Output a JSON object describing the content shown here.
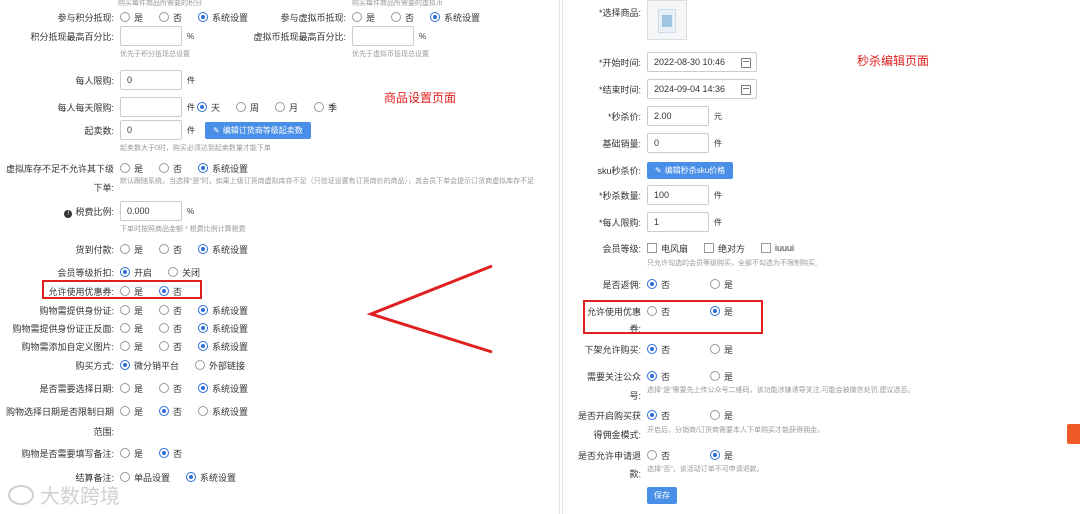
{
  "left": {
    "top_hints": [
      "购买每件商品所需要的积分",
      "购买每件商品所需要的虚拟币"
    ],
    "points_offset": {
      "label": "参与积分抵现:",
      "options": [
        "是",
        "否",
        "系统设置"
      ]
    },
    "virtual_offset": {
      "label": "参与虚拟币抵现:",
      "options": [
        "是",
        "否",
        "系统设置"
      ]
    },
    "points_pct": {
      "label": "积分抵现最高百分比:",
      "unit": "%",
      "hint": "优先于积分抵现总设置"
    },
    "virtual_pct": {
      "label": "虚拟币抵现最高百分比:",
      "unit": "%",
      "hint": "优先于虚拟币抵现总设置"
    },
    "per_person_limit": {
      "label": "每人限购:",
      "value": "0",
      "unit": "件"
    },
    "per_day_limit": {
      "label": "每人每天限购:",
      "unit": "件",
      "options": [
        "天",
        "周",
        "月",
        "季"
      ]
    },
    "min_qty": {
      "label": "起卖数:",
      "value": "0",
      "unit": "件",
      "button": "编辑订货商等级起卖数",
      "hint": "起卖数大于0时，购买必须达到起卖数量才能下单"
    },
    "virtual_stock": {
      "label_line1": "虚拟库存不足不允许其下级",
      "label_line2": "下单:",
      "options": [
        "是",
        "否",
        "系统设置"
      ],
      "hint": "默认跟随系统，当选择“是”时，如果上级订货商虚拟库存不足（只验证设置有订货商价的商品），其会员下单会提示订货商虚拟库存不足"
    },
    "tax_rate": {
      "label": "税费比例:",
      "value": "0.000",
      "unit": "%",
      "hint": "下单时按照商品金额 * 税费比例计算税费"
    },
    "cod": {
      "label": "货到付款:",
      "options": [
        "是",
        "否",
        "系统设置"
      ]
    },
    "member_discount": {
      "label": "会员等级折扣:",
      "options": [
        "开启",
        "关闭"
      ]
    },
    "allow_coupon": {
      "label": "允许使用优惠券:",
      "options": [
        "是",
        "否"
      ]
    },
    "need_id": {
      "label": "购物需提供身份证:",
      "options": [
        "是",
        "否",
        "系统设置"
      ]
    },
    "need_id_photo": {
      "label": "购物需提供身份证正反面:",
      "options": [
        "是",
        "否",
        "系统设置"
      ]
    },
    "need_custom_img": {
      "label": "购物需添加自定义图片:",
      "options": [
        "是",
        "否",
        "系统设置"
      ]
    },
    "buy_method": {
      "label": "购买方式:",
      "options": [
        "微分销平台",
        "外部链接"
      ]
    },
    "need_date": {
      "label": "是否需要选择日期:",
      "options": [
        "是",
        "否",
        "系统设置"
      ]
    },
    "date_range": {
      "label_line1": "购物选择日期是否限制日期",
      "label_line2": "范围:",
      "options": [
        "是",
        "否",
        "系统设置"
      ]
    },
    "need_note": {
      "label": "购物是否需要填写备注:",
      "options": [
        "是",
        "否"
      ]
    },
    "settle_note": {
      "label": "结算备注:",
      "options": [
        "单品设置",
        "系统设置"
      ]
    },
    "annotation": "商品设置页面"
  },
  "right": {
    "select_goods": {
      "label": "*选择商品:"
    },
    "start_time": {
      "label": "*开始时间:",
      "value": "2022-08-30 10:46"
    },
    "end_time": {
      "label": "*结束时间:",
      "value": "2024-09-04 14:36"
    },
    "price": {
      "label": "*秒杀价:",
      "value": "2.00",
      "unit": "元"
    },
    "base_sales": {
      "label": "基础销量:",
      "value": "0",
      "unit": "件"
    },
    "sku_price": {
      "label": "sku秒杀价:",
      "button": "编辑秒杀sku价格"
    },
    "qty": {
      "label": "*秒杀数量:",
      "value": "100",
      "unit": "件"
    },
    "per_limit": {
      "label": "*每人限购:",
      "value": "1",
      "unit": "件"
    },
    "member_level": {
      "label": "会员等级:",
      "options": [
        "电风扇",
        "绝对方",
        "iuuui"
      ],
      "hint": "只允许勾选的会员等级购买，全部不勾选为不限制购买;"
    },
    "rebate": {
      "label": "是否返佣:",
      "options": [
        "否",
        "是"
      ]
    },
    "allow_coupon": {
      "label_line1": "允许使用优惠",
      "label_line2": "券:",
      "options": [
        "否",
        "是"
      ]
    },
    "off_shelf": {
      "label": "下架允许购买:",
      "options": [
        "否",
        "是"
      ]
    },
    "follow": {
      "label_line1": "需要关注公众",
      "label_line2": "号:",
      "options": [
        "否",
        "是"
      ],
      "hint": "选择“是”需要先上传公众号二维码，该功能涉嫌诱导关注,可能会被微信处罚,建议选否。"
    },
    "commission": {
      "label_line1": "是否开启购买获",
      "label_line2": "得佣金模式:",
      "options": [
        "否",
        "是"
      ],
      "hint": "开启后，分销商/订货商需要本人下单购买才能获得佣金。"
    },
    "refund": {
      "label_line1": "是否允许申请退",
      "label_line2": "款:",
      "options": [
        "否",
        "是"
      ],
      "hint": "选择“否”，该活动订单不可申请退款。"
    },
    "save": "保存",
    "annotation": "秒杀编辑页面"
  },
  "watermark": "大数跨境",
  "colors": {
    "accent": "#2d6dd8",
    "button": "#4a8fe7",
    "highlight": "#e02020"
  }
}
